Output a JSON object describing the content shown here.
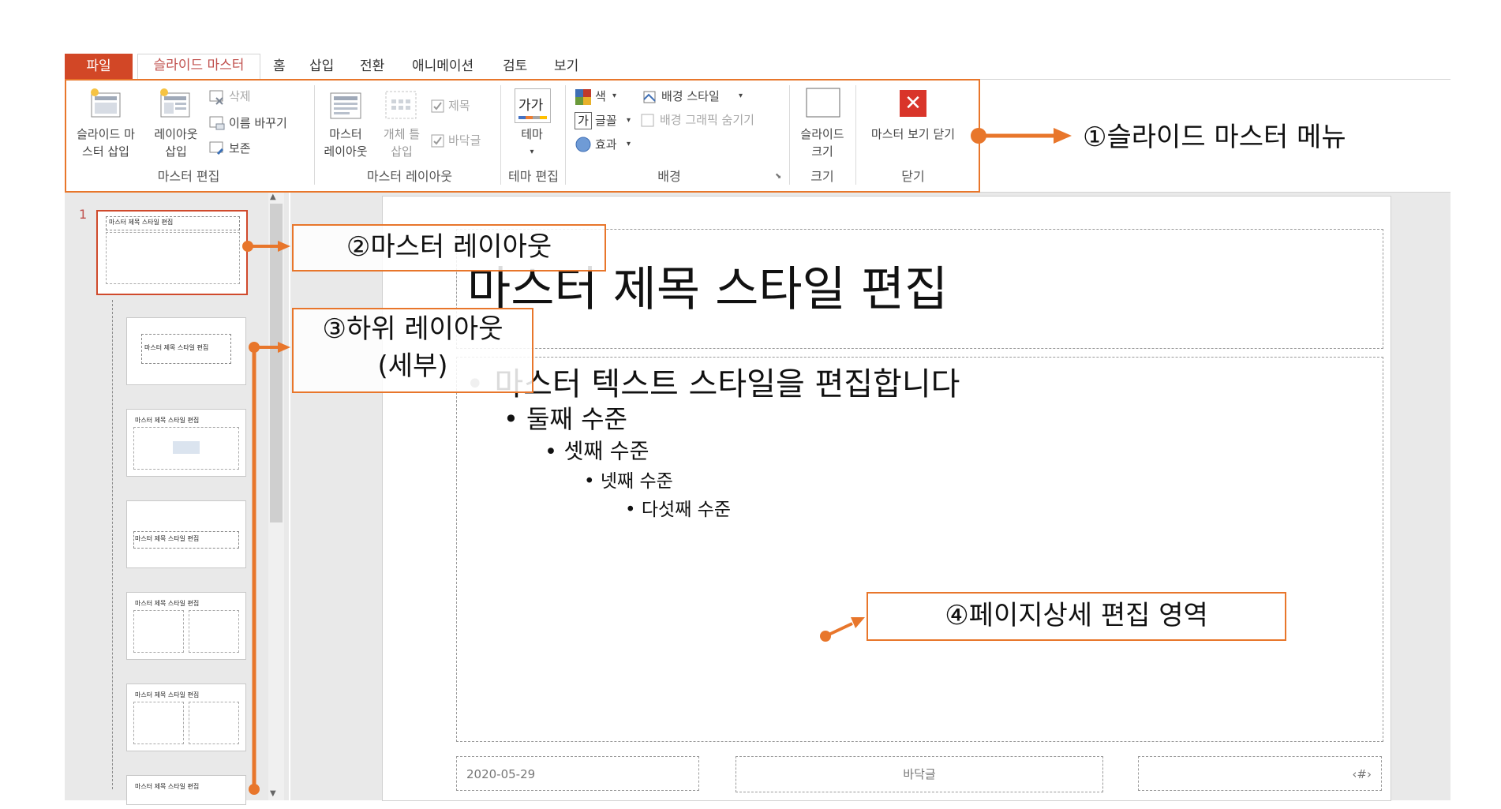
{
  "tabs": {
    "file": "파일",
    "slide_master": "슬라이드 마스터",
    "home": "홈",
    "insert": "삽입",
    "transition": "전환",
    "animation": "애니메이션",
    "review": "검토",
    "view": "보기"
  },
  "ribbon": {
    "insert_master_l1": "슬라이드 마",
    "insert_master_l2": "스터 삽입",
    "insert_layout_l1": "레이아웃",
    "insert_layout_l2": "삽입",
    "delete": "삭제",
    "rename": "이름 바꾸기",
    "preserve": "보존",
    "group_master_edit": "마스터 편집",
    "master_layout_l1": "마스터",
    "master_layout_l2": "레이아웃",
    "insert_placeholder_l1": "개체 틀",
    "insert_placeholder_l2": "삽입",
    "title_check": "제목",
    "footer_check": "바닥글",
    "group_master_layout": "마스터 레이아웃",
    "theme": "테마",
    "theme_icon_text": "가가",
    "group_theme_edit": "테마 편집",
    "colors": "색",
    "fonts": "글꼴",
    "fonts_icon_text": "가",
    "effects": "효과",
    "bg_style": "배경 스타일",
    "hide_bg_graphics": "배경 그래픽 숨기기",
    "group_background": "배경",
    "slide_size_l1": "슬라이드",
    "slide_size_l2": "크기",
    "group_size": "크기",
    "close_master": "마스터 보기 닫기",
    "group_close": "닫기"
  },
  "annotations": {
    "a1": "①슬라이드 마스터 메뉴",
    "a2": "②마스터 레이아웃",
    "a3_l1": "③하위 레이아웃",
    "a3_l2": "(세부)",
    "a4": "④페이지상세 편집 영역"
  },
  "thumbnails": {
    "number": "1",
    "title_text": "마스터 제목 스타일 편집"
  },
  "slide": {
    "title": "마스터 제목 스타일 편집",
    "level1": "마스터 텍스트 스타일을 편집합니다",
    "level2": "둘째 수준",
    "level3": "셋째 수준",
    "level4": "넷째 수준",
    "level5": "다섯째 수준",
    "date": "2020-05-29",
    "footer": "바닥글",
    "page_number": "‹#›"
  },
  "colors": {
    "accent_orange": "#e8762b",
    "file_tab": "#d24726",
    "active_tab_text": "#c0504d",
    "close_red": "#d9352a"
  }
}
